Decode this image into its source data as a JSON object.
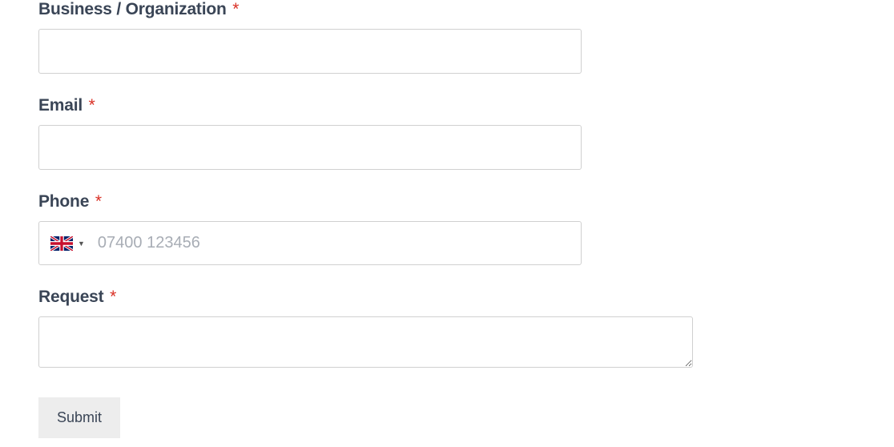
{
  "form": {
    "fields": {
      "business": {
        "label": "Business / Organization",
        "required_mark": "*",
        "value": ""
      },
      "email": {
        "label": "Email",
        "required_mark": "*",
        "value": ""
      },
      "phone": {
        "label": "Phone",
        "required_mark": "*",
        "country_flag": "uk-flag",
        "placeholder": "07400 123456",
        "value": ""
      },
      "request": {
        "label": "Request",
        "required_mark": "*",
        "value": ""
      }
    },
    "submit_label": "Submit"
  }
}
